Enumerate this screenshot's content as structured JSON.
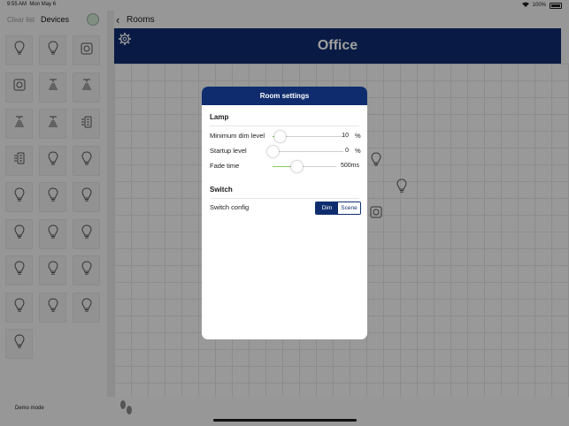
{
  "status": {
    "time": "9:55 AM",
    "date": "Mon May 6",
    "battery": "100%"
  },
  "left": {
    "clear_label": "Clear list",
    "title": "Devices"
  },
  "device_icons": [
    "bulb",
    "bulb",
    "switch",
    "switch",
    "sensor",
    "sensor",
    "sensor",
    "sensor",
    "panel",
    "panel",
    "bulb",
    "bulb",
    "bulb",
    "bulb",
    "bulb",
    "bulb",
    "bulb",
    "bulb",
    "bulb",
    "bulb",
    "bulb",
    "bulb",
    "bulb",
    "bulb",
    "bulb"
  ],
  "nav": {
    "back_label": "Rooms"
  },
  "room": {
    "title": "Office"
  },
  "bottom": {
    "demo_label": "Demo mode"
  },
  "modal": {
    "title": "Room settings",
    "lamp": {
      "heading": "Lamp",
      "min_dim": {
        "label": "Minimum dim level",
        "value": "10",
        "unit": "%",
        "level": 0.1
      },
      "startup": {
        "label": "Startup level",
        "value": "0",
        "unit": "%",
        "level": 0.0
      },
      "fade": {
        "label": "Fade time",
        "value": "500ms",
        "level": 0.38
      }
    },
    "switch": {
      "heading": "Switch",
      "config_label": "Switch config",
      "options": [
        "Dim",
        "Scene"
      ],
      "selected": "Dim"
    }
  },
  "colors": {
    "brand": "#0f2d6e",
    "slider_fill": "#8bcf5c"
  }
}
